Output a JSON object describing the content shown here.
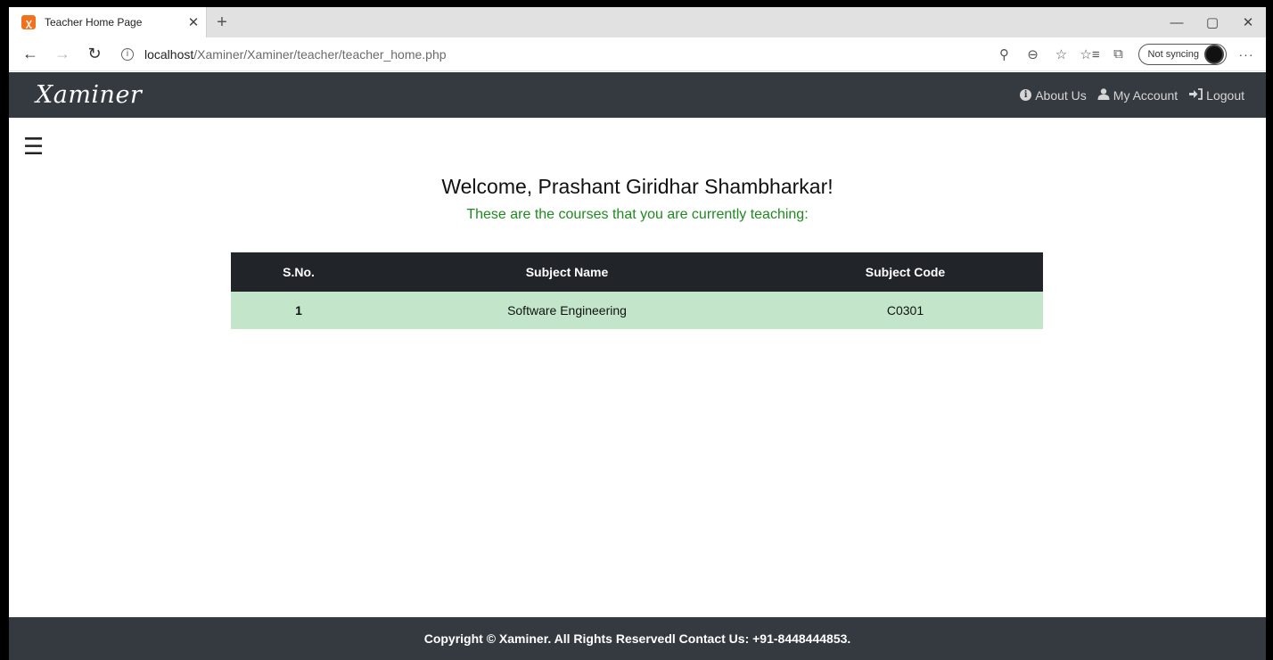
{
  "browser": {
    "tab_title": "Teacher Home Page",
    "tab_favicon": "xampp-icon",
    "url_host": "localhost",
    "url_path": "/Xaminer/Xaminer/teacher/teacher_home.php",
    "sync_label": "Not syncing",
    "icons": {
      "back": "←",
      "forward": "→",
      "refresh": "↻",
      "info": "i",
      "close_tab": "✕",
      "new_tab": "+",
      "minimize": "—",
      "restore": "▢",
      "close_window": "✕",
      "key": "⚲",
      "zoom": "⊖",
      "favorite": "☆",
      "favorites_list": "☆≡",
      "collections": "⧉",
      "more": "···"
    }
  },
  "navbar": {
    "brand": "Xaminer",
    "links": {
      "about": "About Us",
      "account": "My Account",
      "logout": "Logout"
    }
  },
  "main": {
    "menu_icon": "☰",
    "welcome": "Welcome, Prashant Giridhar Shambharkar!",
    "subtitle": "These are the courses that you are currently teaching:",
    "table": {
      "headers": [
        "S.No.",
        "Subject Name",
        "Subject Code"
      ],
      "rows": [
        [
          "1",
          "Software Engineering",
          "C0301"
        ]
      ]
    }
  },
  "footer": {
    "text": "Copyright © Xaminer. All Rights Reservedl Contact Us: +91-8448444853."
  },
  "colors": {
    "navbar_bg": "#343a40",
    "table_header_bg": "#212529",
    "table_row_bg": "#c3e6cb",
    "subtitle_green": "#1f8a1f"
  }
}
